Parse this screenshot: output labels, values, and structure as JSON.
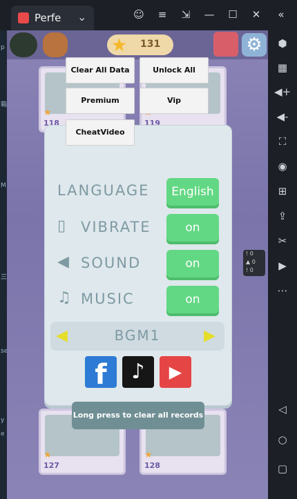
{
  "window": {
    "tab_title": "Perfe",
    "tab_close": "⌄",
    "controls": [
      "☺",
      "≡",
      "⇲",
      "—",
      "☐",
      "✕",
      "«"
    ]
  },
  "left_strip": [
    "p",
    "箱",
    "M",
    "三",
    "se",
    "y",
    "e"
  ],
  "hud": {
    "star_count": "131"
  },
  "cards": [
    {
      "num": "118"
    },
    {
      "num": "119"
    },
    {
      "num": "127"
    },
    {
      "num": "128"
    }
  ],
  "debug_menu": {
    "clear_all_data": "Clear All Data",
    "unlock_all_level": "Unlock All Level",
    "premium": "Premium",
    "vip": "Vip",
    "cheat_video": "CheatVideo"
  },
  "settings": {
    "language_label": "LANGUAGE",
    "language_value": "English",
    "vibrate_label": "VIBRATE",
    "vibrate_value": "on",
    "sound_label": "SOUND",
    "sound_value": "on",
    "music_label": "MUSIC",
    "music_value": "on",
    "bgm_value": "BGM1",
    "clear_records": "Long press to clear all records"
  },
  "warnings": [
    "0",
    "0",
    "0"
  ],
  "colors": {
    "accent_green": "#63d884",
    "panel_bg": "#dfe8ec",
    "label_gray": "#7e9aa3",
    "arrow_yellow": "#e6dd2a"
  }
}
